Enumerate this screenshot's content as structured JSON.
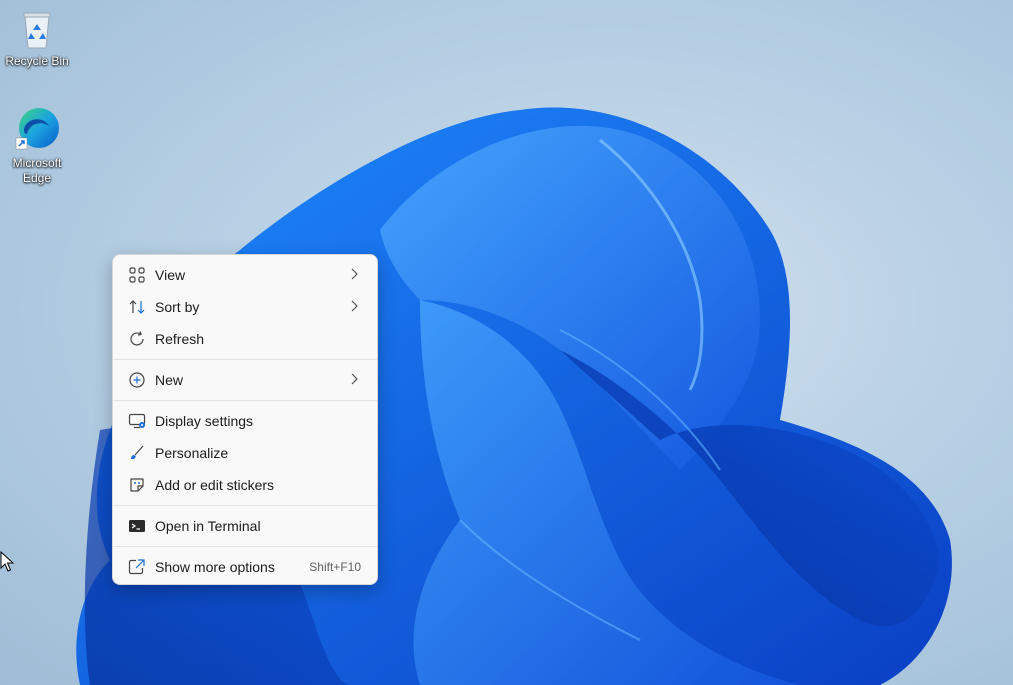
{
  "desktop": {
    "icons": [
      {
        "label": "Recycle Bin",
        "icon": "recycle-bin-icon"
      },
      {
        "label": "Microsoft Edge",
        "icon": "edge-icon"
      }
    ]
  },
  "context_menu": {
    "items": [
      {
        "label": "View",
        "icon": "grid-icon",
        "submenu": true
      },
      {
        "label": "Sort by",
        "icon": "sort-icon",
        "submenu": true
      },
      {
        "label": "Refresh",
        "icon": "refresh-icon"
      },
      {
        "label": "New",
        "icon": "plus-circle-icon",
        "submenu": true
      },
      {
        "label": "Display settings",
        "icon": "display-settings-icon"
      },
      {
        "label": "Personalize",
        "icon": "brush-icon"
      },
      {
        "label": "Add or edit stickers",
        "icon": "sticker-icon"
      },
      {
        "label": "Open in Terminal",
        "icon": "terminal-icon"
      },
      {
        "label": "Show more options",
        "icon": "share-icon",
        "accelerator": "Shift+F10"
      }
    ]
  },
  "colors": {
    "accent": "#0f6cd8",
    "menu_bg": "#f9f9f9"
  }
}
